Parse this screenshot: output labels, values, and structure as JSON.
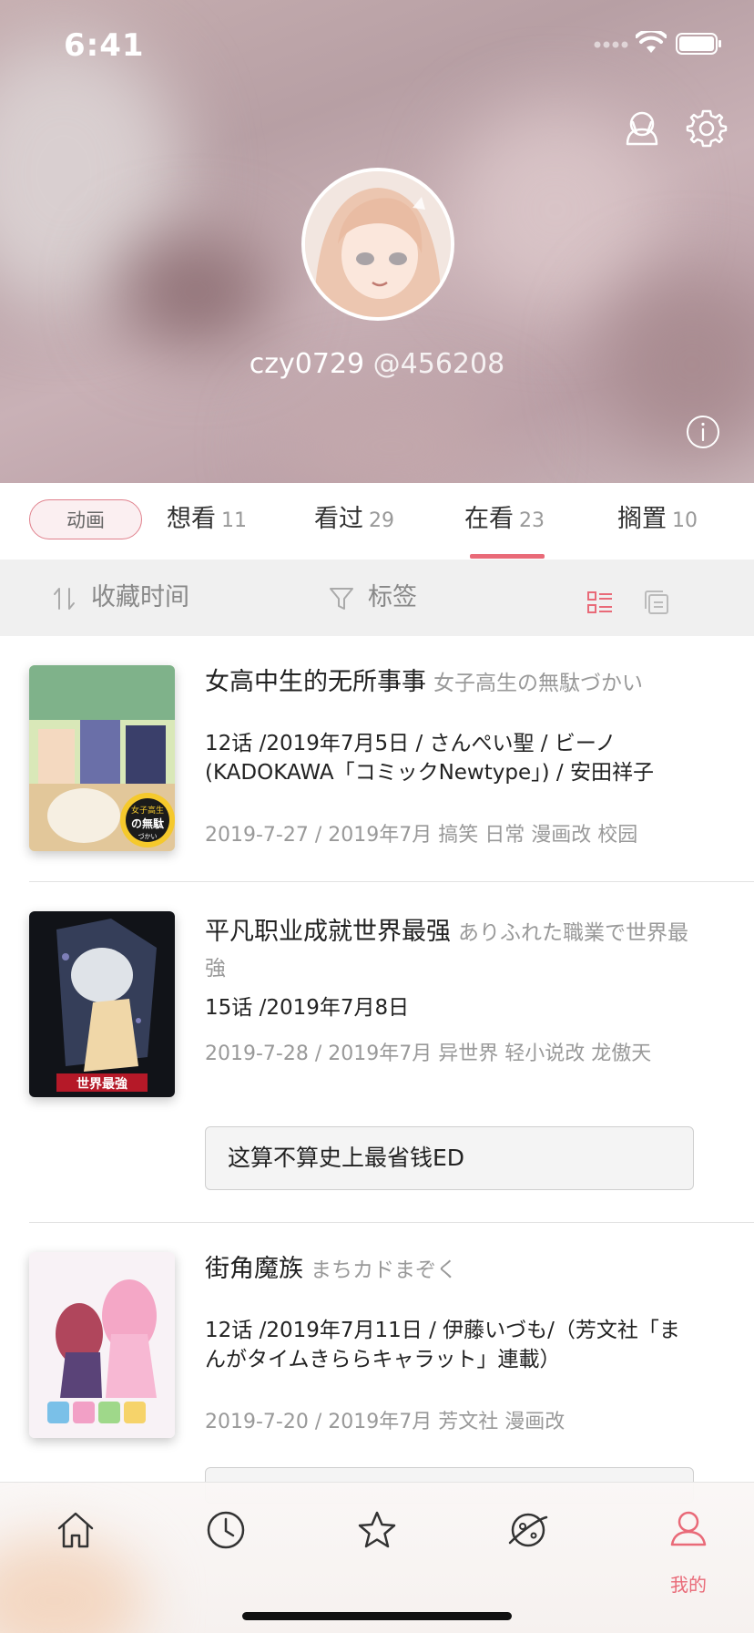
{
  "status_bar": {
    "time": "6:41"
  },
  "profile": {
    "name": "czy0729",
    "handle": "@456208"
  },
  "category_chip": "动画",
  "tabs": [
    {
      "label": "想看",
      "count": "11"
    },
    {
      "label": "看过",
      "count": "29"
    },
    {
      "label": "在看",
      "count": "23",
      "active": true
    },
    {
      "label": "搁置",
      "count": "10"
    }
  ],
  "filter": {
    "sort_label": "收藏时间",
    "tag_label": "标签",
    "view_mode": "list"
  },
  "items": [
    {
      "title": "女高中生的无所事事",
      "title_jp": "女子高生の無駄づかい",
      "meta": "12话 /2019年7月5日 / さんぺい聖 / ビーノ (KADOKAWA「コミックNewtype」) / 安田祥子",
      "tags": "2019-7-27 / 2019年7月 搞笑 日常 漫画改 校园",
      "cover_text_1": "女子高生",
      "cover_text_2": "の無駄",
      "cover_text_3": "づかい"
    },
    {
      "title": "平凡职业成就世界最强",
      "title_jp": "ありふれた職業で世界最強",
      "meta": "15话 /2019年7月8日",
      "tags": "2019-7-28 / 2019年7月 异世界 轻小说改 龙傲天",
      "comment": "这算不算史上最省钱ED",
      "cover_text_1": "世界最強"
    },
    {
      "title": "街角魔族",
      "title_jp": "まちカドまぞく",
      "meta": "12话 /2019年7月11日 / 伊藤いづも/（芳文社「まんがタイムきららキャラット」連載）",
      "tags": "2019-7-20 / 2019年7月 芳文社 漫画改"
    }
  ],
  "bottom_tabs": [
    {
      "icon": "home-icon"
    },
    {
      "icon": "clock-icon"
    },
    {
      "icon": "star-icon"
    },
    {
      "icon": "planet-icon"
    },
    {
      "icon": "user-icon",
      "label": "我的",
      "active": true
    }
  ],
  "colors": {
    "accent": "#e96a78",
    "chip_bg": "#fbeff1",
    "filter_bg": "#f0f0f0"
  }
}
